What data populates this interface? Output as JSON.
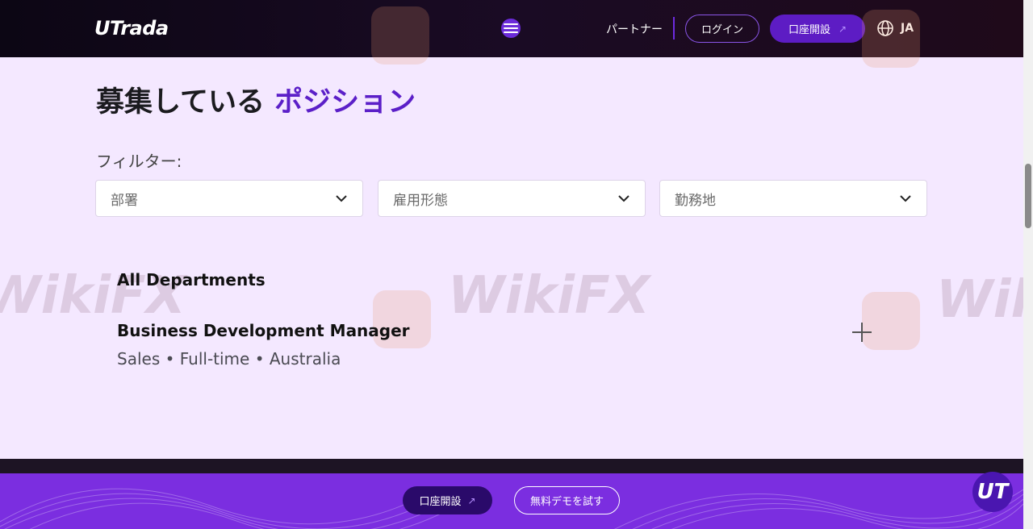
{
  "header": {
    "logo": "UTrada",
    "nav_partner": "パートナー",
    "login_label": "ログイン",
    "open_account_label": "口座開設",
    "open_account_arrow": "↗",
    "language": "JA"
  },
  "main": {
    "title_main": "募集している",
    "title_accent": "ポジション",
    "filter_label": "フィルター:",
    "filters": [
      {
        "placeholder": "部署"
      },
      {
        "placeholder": "雇用形態"
      },
      {
        "placeholder": "勤務地"
      }
    ],
    "department_heading": "All Departments",
    "job": {
      "title": "Business Development Manager",
      "meta": "Sales • Full-time • Australia"
    }
  },
  "footer": {
    "open_account_label": "口座開設",
    "open_account_arrow": "↗",
    "demo_label": "無料デモを試す",
    "badge": "UT"
  },
  "watermark": {
    "text": "WikiFX"
  },
  "colors": {
    "accent": "#5b1fc8",
    "page_bg": "#f4e8ff",
    "header_bg": "#0c0614",
    "footer_bg": "#7b2ee0"
  },
  "icons": {
    "menu": "menu-toggle-icon",
    "globe": "globe-icon",
    "chevron": "chevron-down-icon",
    "plus": "plus-icon",
    "arrow": "arrow-up-right-icon"
  }
}
